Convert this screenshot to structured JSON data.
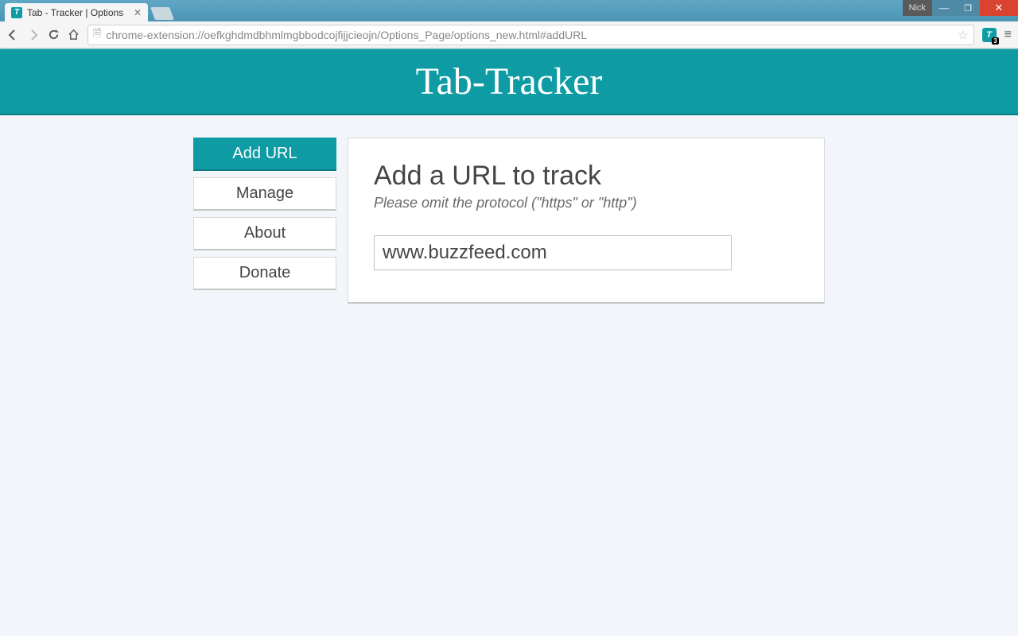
{
  "browser": {
    "tab_title": "Tab - Tracker | Options",
    "user_badge": "Nick",
    "url": "chrome-extension://oefkghdmdbhmlmgbbodcojfijjcieojn/Options_Page/options_new.html#addURL",
    "ext_badge": "3"
  },
  "banner": {
    "title": "Tab-Tracker"
  },
  "sidebar": {
    "items": [
      {
        "label": "Add URL",
        "active": true
      },
      {
        "label": "Manage",
        "active": false
      },
      {
        "label": "About",
        "active": false
      },
      {
        "label": "Donate",
        "active": false
      }
    ]
  },
  "panel": {
    "heading": "Add a URL to track",
    "subheading": "Please omit the protocol (\"https\" or \"http\")",
    "url_value": "www.buzzfeed.com"
  }
}
